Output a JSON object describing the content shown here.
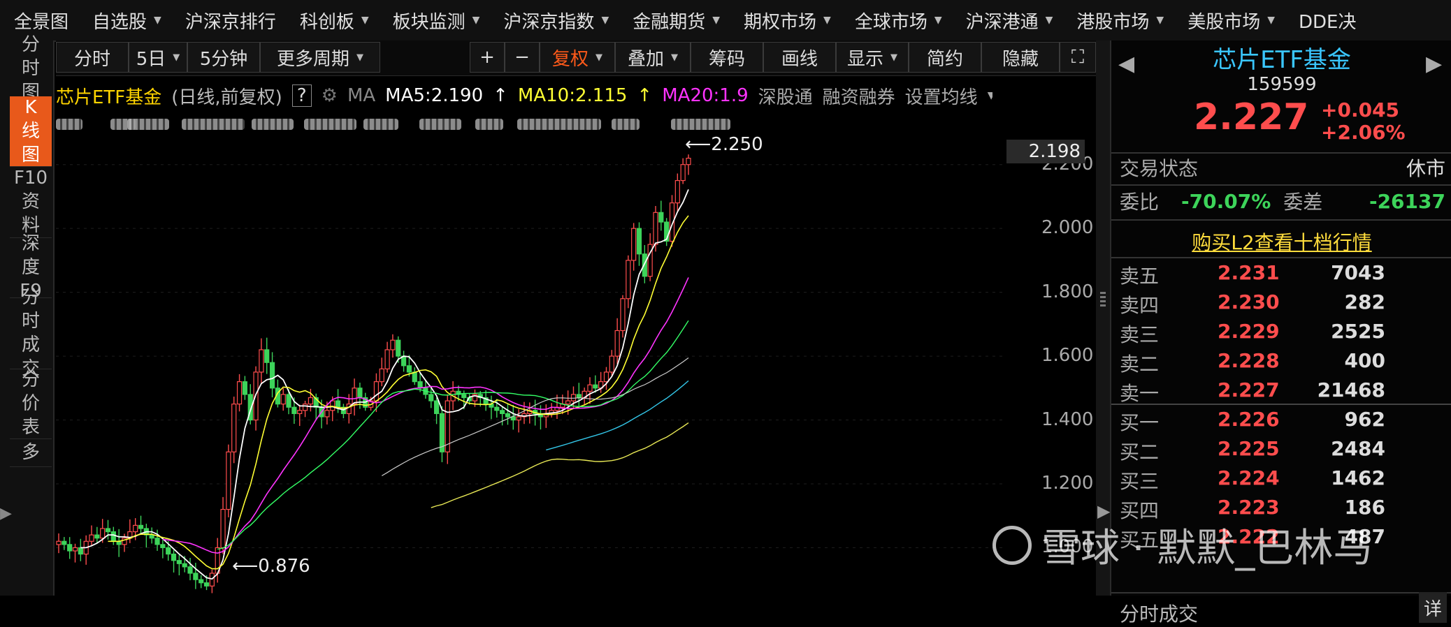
{
  "nav": {
    "items": [
      {
        "label": "全景图",
        "dropdown": false
      },
      {
        "label": "自选股",
        "dropdown": true
      },
      {
        "label": "沪深京排行",
        "dropdown": false
      },
      {
        "label": "科创板",
        "dropdown": true
      },
      {
        "label": "板块监测",
        "dropdown": true
      },
      {
        "label": "沪深京指数",
        "dropdown": true
      },
      {
        "label": "金融期货",
        "dropdown": true
      },
      {
        "label": "期权市场",
        "dropdown": true
      },
      {
        "label": "全球市场",
        "dropdown": true
      },
      {
        "label": "沪深港通",
        "dropdown": true
      },
      {
        "label": "港股市场",
        "dropdown": true
      },
      {
        "label": "美股市场",
        "dropdown": true
      },
      {
        "label": "DDE决",
        "dropdown": false
      }
    ]
  },
  "sidebar": {
    "tabs": [
      {
        "chars": [
          "分",
          "时",
          "图"
        ],
        "active": false
      },
      {
        "chars": [
          "K",
          "线",
          "图"
        ],
        "active": true
      },
      {
        "chars": [
          "F10",
          "资",
          "料"
        ],
        "active": false
      },
      {
        "chars": [
          "深",
          "度",
          "F9"
        ],
        "active": false
      },
      {
        "chars": [
          "分",
          "时",
          "成",
          "交"
        ],
        "active": false
      },
      {
        "chars": [
          "分",
          "价",
          "表"
        ],
        "active": false
      },
      {
        "chars": [
          "多"
        ],
        "active": false
      }
    ]
  },
  "toolbar": {
    "period_buttons": [
      "分时",
      "5日",
      "5分钟",
      "更多周期"
    ],
    "tools": [
      "复权",
      "叠加",
      "筹码",
      "画线",
      "显示",
      "简约",
      "隐藏"
    ],
    "zoom_in": "+",
    "zoom_out": "−"
  },
  "info": {
    "name": "芯片ETF基金",
    "mode": "(日线,前复权)",
    "help": "?",
    "ma_label": "MA",
    "ma5": "MA5:2.190",
    "ma10": "MA10:2.115",
    "ma20": "MA20:1.9",
    "links": [
      "深股通",
      "融资融券",
      "设置均线"
    ]
  },
  "axis": {
    "current": "2.198",
    "ticks": [
      "2.200",
      "2.000",
      "1.800",
      "1.600",
      "1.400",
      "1.200",
      "1.000"
    ]
  },
  "chart_labels": {
    "high": "2.250",
    "low": "0.876"
  },
  "chart_data": {
    "type": "candlestick",
    "title": "芯片ETF基金",
    "ylim": [
      0.85,
      2.3
    ],
    "high_marker": 2.25,
    "low_marker": 0.876,
    "close_path": [
      1.02,
      1.01,
      0.99,
      1.0,
      0.98,
      1.02,
      1.04,
      1.03,
      1.06,
      1.05,
      1.02,
      1.01,
      1.03,
      1.05,
      1.07,
      1.06,
      1.04,
      1.03,
      1.01,
      1.0,
      0.98,
      0.96,
      0.95,
      0.94,
      0.92,
      0.9,
      0.89,
      0.88,
      0.92,
      1.0,
      1.12,
      1.3,
      1.45,
      1.52,
      1.48,
      1.4,
      1.55,
      1.62,
      1.58,
      1.5,
      1.45,
      1.48,
      1.44,
      1.42,
      1.43,
      1.45,
      1.47,
      1.44,
      1.41,
      1.43,
      1.46,
      1.44,
      1.42,
      1.45,
      1.5,
      1.47,
      1.44,
      1.46,
      1.52,
      1.56,
      1.62,
      1.65,
      1.6,
      1.57,
      1.55,
      1.52,
      1.5,
      1.48,
      1.46,
      1.42,
      1.3,
      1.46,
      1.49,
      1.48,
      1.47,
      1.46,
      1.48,
      1.47,
      1.45,
      1.44,
      1.43,
      1.42,
      1.41,
      1.4,
      1.41,
      1.42,
      1.43,
      1.42,
      1.41,
      1.42,
      1.43,
      1.44,
      1.45,
      1.46,
      1.48,
      1.47,
      1.49,
      1.51,
      1.5,
      1.52,
      1.55,
      1.6,
      1.68,
      1.78,
      1.9,
      2.0,
      1.92,
      1.85,
      1.95,
      2.05,
      2.02,
      1.96,
      2.08,
      2.15,
      2.2,
      2.22
    ]
  },
  "quote": {
    "name": "芯片ETF基金",
    "code": "159599",
    "price": "2.227",
    "change": "+0.045",
    "change_pct": "+2.06%",
    "status_label": "交易状态",
    "status_value": "休市",
    "weibi_label": "委比",
    "weibi_value": "-70.07%",
    "weicha_label": "委差",
    "weicha_value": "-26137",
    "l2_link": "购买L2查看十档行情",
    "asks": [
      {
        "label": "卖五",
        "price": "2.231",
        "vol": "7043"
      },
      {
        "label": "卖四",
        "price": "2.230",
        "vol": "282"
      },
      {
        "label": "卖三",
        "price": "2.229",
        "vol": "2525"
      },
      {
        "label": "卖二",
        "price": "2.228",
        "vol": "400"
      },
      {
        "label": "卖一",
        "price": "2.227",
        "vol": "21468"
      }
    ],
    "bids": [
      {
        "label": "买一",
        "price": "2.226",
        "vol": "962"
      },
      {
        "label": "买二",
        "price": "2.225",
        "vol": "2484"
      },
      {
        "label": "买三",
        "price": "2.224",
        "vol": "1462"
      },
      {
        "label": "买四",
        "price": "2.223",
        "vol": "186"
      },
      {
        "label": "买五",
        "price": "2.222",
        "vol": "487"
      }
    ],
    "footer_tab": "分时成交",
    "detail": "详"
  },
  "watermark": {
    "text": "雪球 · 默默_巴林马"
  },
  "colors": {
    "up": "#ff4d4d",
    "down": "#3dd45a",
    "ma5": "#ffffff",
    "ma10": "#ffff33",
    "ma20": "#ff33ff",
    "ma30": "#33ff66",
    "ma60": "#cccccc",
    "ma120": "#33c6e8",
    "ma250": "#e8e855",
    "accent": "#e8591b"
  }
}
